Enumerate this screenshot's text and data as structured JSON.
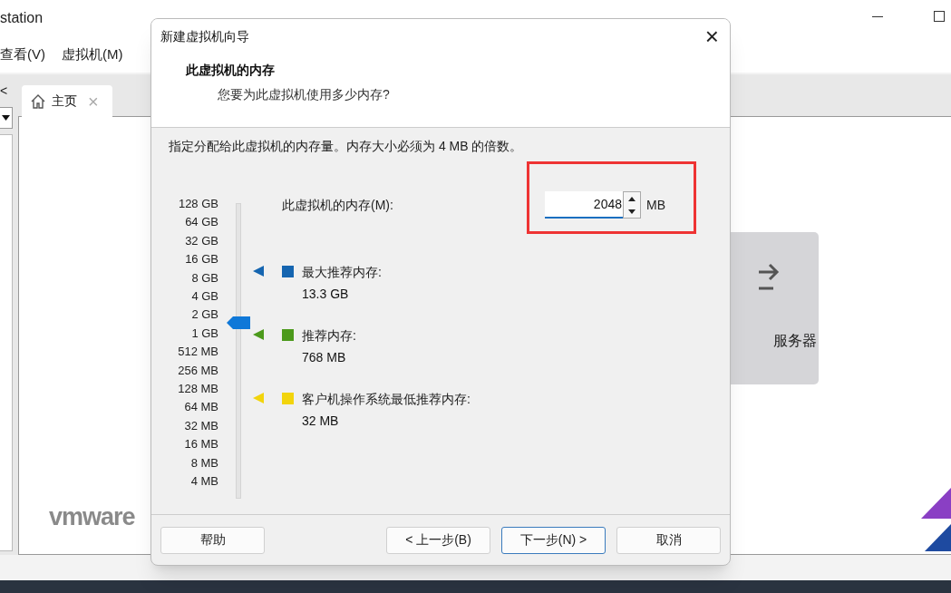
{
  "app": {
    "title": "station",
    "menu": [
      "查看(V)",
      "虚拟机(M)"
    ],
    "back_glyph": "<",
    "tab": {
      "label": "主页",
      "close": "×",
      "selected": true
    },
    "card_label": "服务器",
    "logo": "vmware"
  },
  "dialog": {
    "title": "新建虚拟机向导",
    "close": "×",
    "heading": "此虚拟机的内存",
    "subheading": "您要为此虚拟机使用多少内存?",
    "instruction": "指定分配给此虚拟机的内存量。内存大小必须为 4 MB 的倍数。",
    "memory_field": {
      "label": "此虚拟机的内存(M):",
      "value": "2048",
      "unit": "MB",
      "highlighted": true
    },
    "scale": [
      "128 GB",
      "64 GB",
      "32 GB",
      "16 GB",
      "8 GB",
      "4 GB",
      "2 GB",
      "1 GB",
      "512 MB",
      "256 MB",
      "128 MB",
      "64 MB",
      "32 MB",
      "16 MB",
      "8 MB",
      "4 MB"
    ],
    "slider": {
      "level": 0.6
    },
    "recommendations": [
      {
        "label": "最大推荐内存:",
        "value": "13.3 GB",
        "color": "#1565b0"
      },
      {
        "label": "推荐内存:",
        "value": "768 MB",
        "color": "#4c9a1c"
      },
      {
        "label": "客户机操作系统最低推荐内存:",
        "value": "32 MB",
        "color": "#f2d40c"
      }
    ],
    "buttons": [
      {
        "label": "帮助",
        "kind": "help",
        "selected": false
      },
      {
        "label": "< 上一步(B)",
        "kind": "nav",
        "selected": false
      },
      {
        "label": "下一步(N) >",
        "kind": "nav",
        "selected": true
      },
      {
        "label": "取消",
        "kind": "nav",
        "selected": false
      }
    ]
  }
}
